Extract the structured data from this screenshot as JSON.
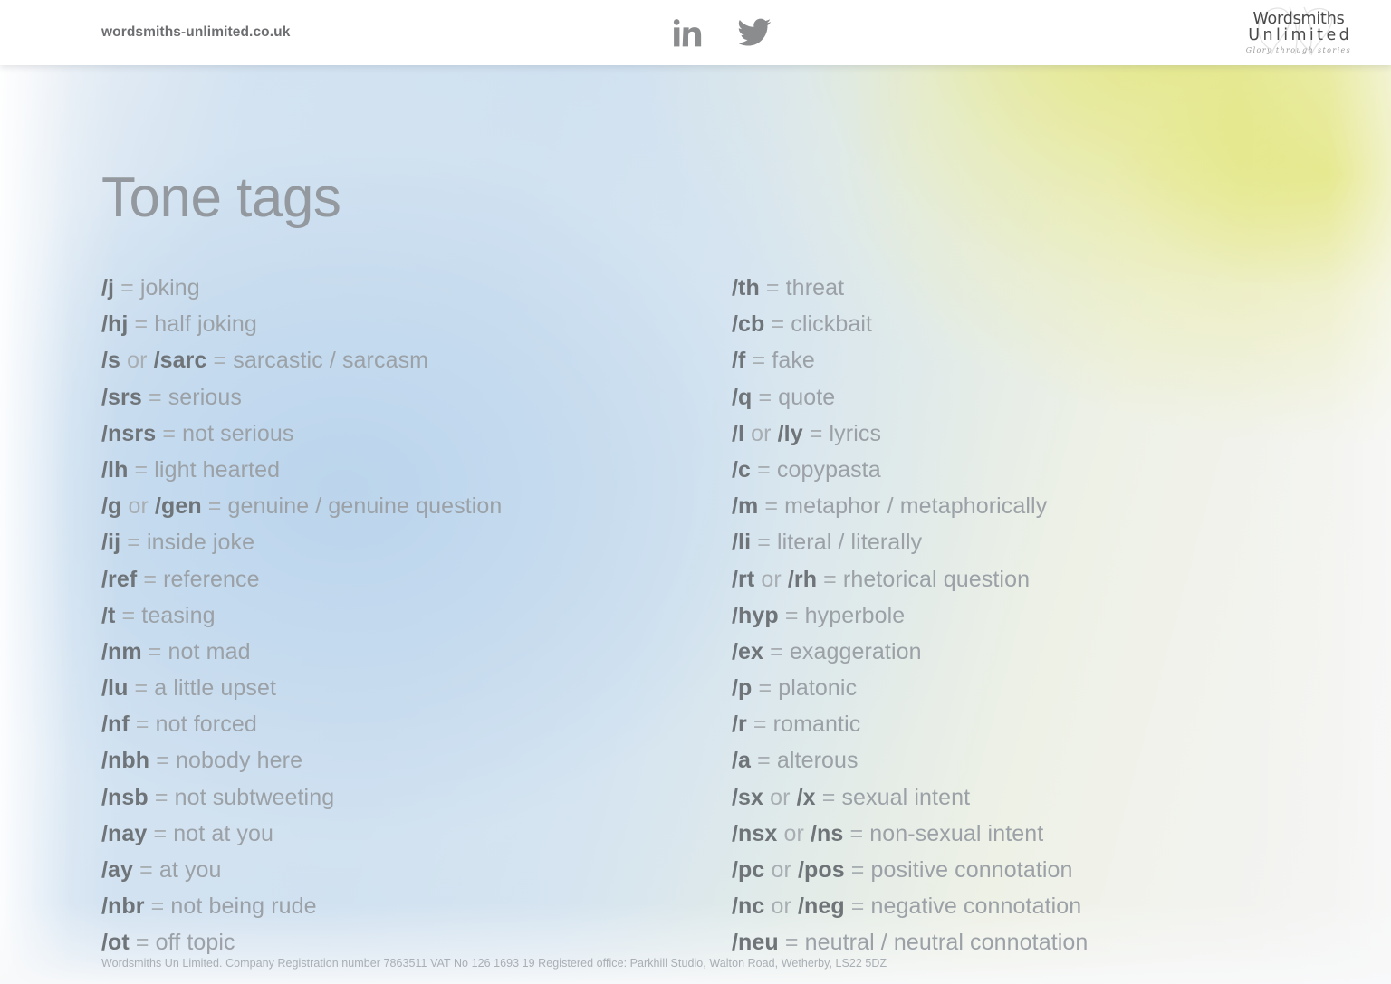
{
  "header": {
    "site_url": "wordsmiths-unlimited.co.uk",
    "social": [
      {
        "name": "linkedin-icon",
        "label": "in"
      },
      {
        "name": "twitter-icon",
        "label": "Twitter"
      }
    ],
    "logo": {
      "line1": "Wordsmiths",
      "line2": "Unlimited",
      "tagline": "Glory through stories"
    }
  },
  "slide": {
    "title": "Tone tags",
    "columns": [
      {
        "id": "left",
        "rows": [
          {
            "code": "/j",
            "alt": "",
            "def": "joking"
          },
          {
            "code": "/hj",
            "alt": "",
            "def": "half joking"
          },
          {
            "code": "/s",
            "alt": "/sarc",
            "def": "sarcastic / sarcasm"
          },
          {
            "code": "/srs",
            "alt": "",
            "def": "serious"
          },
          {
            "code": "/nsrs",
            "alt": "",
            "def": "not serious"
          },
          {
            "code": "/lh",
            "alt": "",
            "def": "light hearted"
          },
          {
            "code": "/g",
            "alt": "/gen",
            "def": "genuine / genuine question"
          },
          {
            "code": "/ij",
            "alt": "",
            "def": "inside joke"
          },
          {
            "code": "/ref",
            "alt": "",
            "def": "reference"
          },
          {
            "code": "/t",
            "alt": "",
            "def": "teasing"
          },
          {
            "code": "/nm",
            "alt": "",
            "def": "not mad"
          },
          {
            "code": "/lu",
            "alt": "",
            "def": "a little upset"
          },
          {
            "code": "/nf",
            "alt": "",
            "def": "not forced"
          },
          {
            "code": "/nbh",
            "alt": "",
            "def": "nobody here"
          },
          {
            "code": "/nsb",
            "alt": "",
            "def": "not subtweeting"
          },
          {
            "code": "/nay",
            "alt": "",
            "def": "not at you"
          },
          {
            "code": "/ay",
            "alt": "",
            "def": "at you"
          },
          {
            "code": "/nbr",
            "alt": "",
            "def": "not being rude"
          },
          {
            "code": "/ot",
            "alt": "",
            "def": "off topic"
          }
        ]
      },
      {
        "id": "right",
        "rows": [
          {
            "code": "/th",
            "alt": "",
            "def": "threat"
          },
          {
            "code": "/cb",
            "alt": "",
            "def": "clickbait"
          },
          {
            "code": "/f",
            "alt": "",
            "def": "fake"
          },
          {
            "code": "/q",
            "alt": "",
            "def": "quote"
          },
          {
            "code": "/l",
            "alt": "/ly",
            "def": "lyrics"
          },
          {
            "code": "/c",
            "alt": "",
            "def": "copypasta"
          },
          {
            "code": "/m",
            "alt": "",
            "def": "metaphor / metaphorically"
          },
          {
            "code": "/li",
            "alt": "",
            "def": "literal / literally"
          },
          {
            "code": "/rt",
            "alt": "/rh",
            "def": "rhetorical question"
          },
          {
            "code": "/hyp",
            "alt": "",
            "def": "hyperbole"
          },
          {
            "code": "/ex",
            "alt": "",
            "def": "exaggeration"
          },
          {
            "code": "/p",
            "alt": "",
            "def": "platonic"
          },
          {
            "code": "/r",
            "alt": "",
            "def": "romantic"
          },
          {
            "code": "/a",
            "alt": "",
            "def": "alterous"
          },
          {
            "code": "/sx",
            "alt": "/x",
            "def": "sexual intent"
          },
          {
            "code": "/nsx",
            "alt": "/ns",
            "def": "non-sexual intent"
          },
          {
            "code": "/pc",
            "alt": "/pos",
            "def": "positive connotation"
          },
          {
            "code": "/nc",
            "alt": "/neg",
            "def": "negative connotation"
          },
          {
            "code": "/neu",
            "alt": "",
            "def": "neutral / neutral connotation"
          }
        ]
      }
    ],
    "separator_or": "or",
    "separator_eq": "="
  },
  "footer": {
    "text": "Wordsmiths Un Limited.  Company Registration number 7863511 VAT No 126 1693 19 Registered office: Parkhill Studio, Walton Road, Wetherby, LS22 5DZ"
  },
  "colors": {
    "tag_code": "#6f7478",
    "tag_def": "#9ba1a6",
    "title": "#93999e",
    "accent_yellow": "#e2e574",
    "accent_blue": "#bad4ec",
    "header_text": "#6d6e71"
  }
}
